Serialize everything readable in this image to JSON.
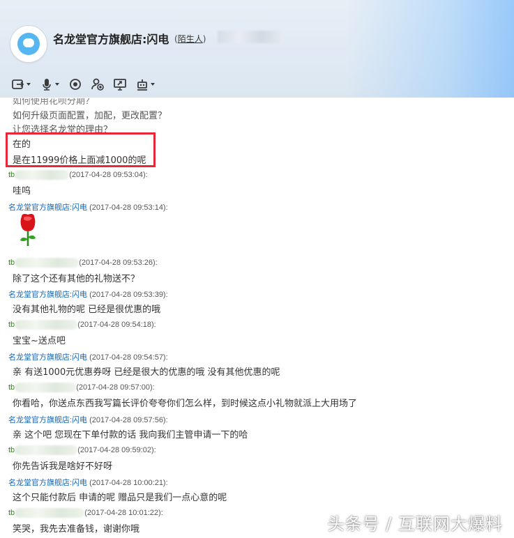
{
  "header": {
    "title": "名龙堂官方旗舰店:闪电",
    "relation_open": "(",
    "relation_label": "陌生人",
    "relation_close": ")"
  },
  "toolbar": {
    "icons": [
      "share-screen-icon",
      "microphone-icon",
      "camera-icon",
      "add-contact-icon",
      "remote-desktop-icon",
      "robot-icon"
    ]
  },
  "faq": {
    "line0": "如何使用花呗分期？",
    "line1": "如何升级页面配置，加配，更改配置？",
    "line2": "让您选择名龙堂的理由？"
  },
  "highlight": {
    "line1": "在的",
    "line2": "是在11999价格上面减1000的呢"
  },
  "messages": [
    {
      "sender": "tb",
      "ts": "(2017-04-28 09:53:04):",
      "text": "哇呜"
    },
    {
      "sender": "名龙堂官方旗舰店:闪电",
      "ts": "(2017-04-28 09:53:14):",
      "text": ""
    },
    {
      "sender": "tb",
      "ts": "(2017-04-28 09:53:26):",
      "text": "除了这个还有其他的礼物送不？"
    },
    {
      "sender": "名龙堂官方旗舰店:闪电",
      "ts": "(2017-04-28 09:53:39):",
      "text": "没有其他礼物的呢  已经是很优惠的哦"
    },
    {
      "sender": "tb",
      "ts": "(2017-04-28 09:54:18):",
      "text": "宝宝~送点吧"
    },
    {
      "sender": "名龙堂官方旗舰店:闪电",
      "ts": "(2017-04-28 09:54:57):",
      "text": "亲  有送1000元优惠券呀  已经是很大的优惠的哦  没有其他优惠的呢"
    },
    {
      "sender": "tb",
      "ts": "(2017-04-28 09:57:00):",
      "text": "你看哈，你送点东西我写篇长评价夸夸你们怎么样，到时候这点小礼物就派上大用场了"
    },
    {
      "sender": "名龙堂官方旗舰店:闪电",
      "ts": "(2017-04-28 09:57:56):",
      "text": "亲 这个吧 您现在下单付款的话  我向我们主管申请一下的哈"
    },
    {
      "sender": "tb",
      "ts": "(2017-04-28 09:59:02):",
      "text": "你先告诉我是啥好不好呀"
    },
    {
      "sender": "名龙堂官方旗舰店:闪电",
      "ts": "(2017-04-28 10:00:21):",
      "text": "这个只能付款后  申请的呢  赠品只是我们一点心意的呢"
    },
    {
      "sender": "tb",
      "ts": "(2017-04-28 10:01:22):",
      "text": "笑哭，我先去准备钱，谢谢你哦"
    }
  ],
  "watermark": "头条号 / 互联网大爆料",
  "colors": {
    "shop_name": "#1466b8",
    "customer_name": "#2f7d1e",
    "highlight_border": "#e6283a"
  }
}
